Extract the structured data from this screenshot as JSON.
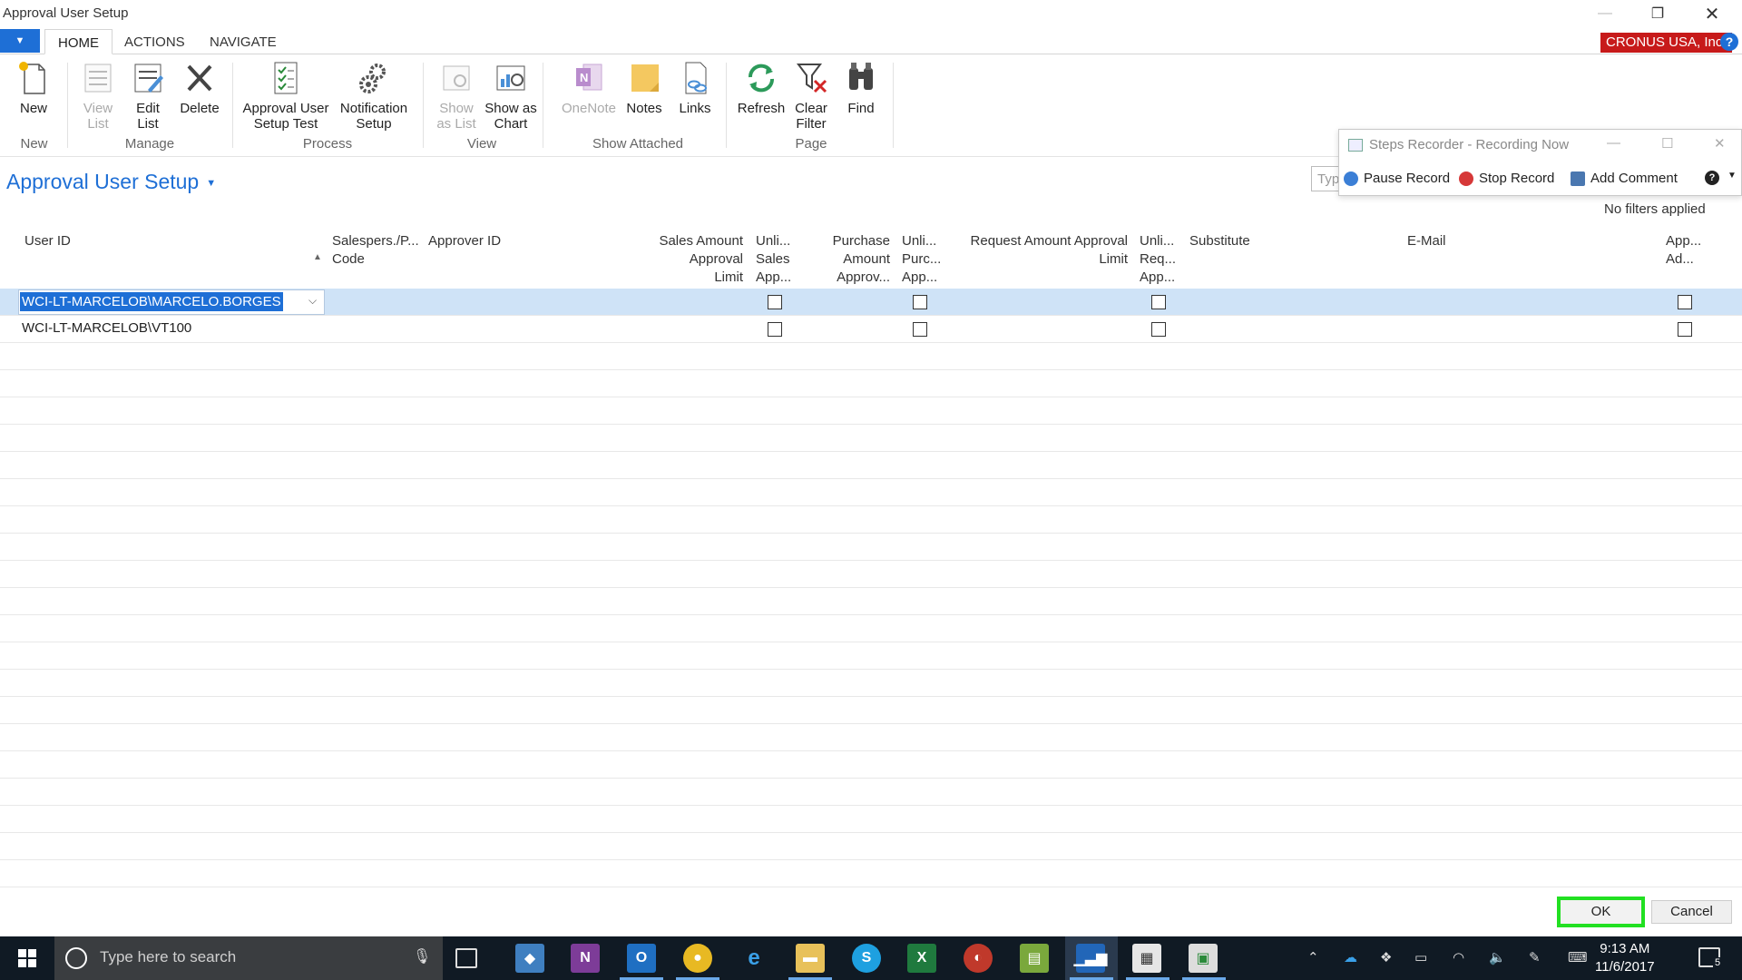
{
  "window": {
    "title": "Approval User Setup"
  },
  "ribbon_tabs": [
    "HOME",
    "ACTIONS",
    "NAVIGATE"
  ],
  "company_badge": "CRONUS USA, Inc.",
  "help_label": "?",
  "ribbon": {
    "buttons": [
      {
        "label": "New"
      },
      {
        "label": "View\nList"
      },
      {
        "label": "Edit\nList"
      },
      {
        "label": "Delete"
      },
      {
        "label": "Approval User\nSetup Test"
      },
      {
        "label": "Notification\nSetup"
      },
      {
        "label": "Show\nas List"
      },
      {
        "label": "Show as\nChart"
      },
      {
        "label": "OneNote"
      },
      {
        "label": "Notes"
      },
      {
        "label": "Links"
      },
      {
        "label": "Refresh"
      },
      {
        "label": "Clear\nFilter"
      },
      {
        "label": "Find"
      }
    ],
    "groups": [
      "New",
      "Manage",
      "Process",
      "View",
      "Show Attached",
      "Page"
    ]
  },
  "page": {
    "title": "Approval User Setup",
    "search_placeholder": "Typ",
    "filter_status": "No filters applied"
  },
  "grid": {
    "columns": [
      "User ID",
      "Salespers./P...\nCode",
      "Approver ID",
      "Sales Amount\nApproval\nLimit",
      "Unli...\nSales\nApp...",
      "Purchase\nAmount\nApprov...",
      "Unli...\nPurc...\nApp...",
      "Request Amount Approval\nLimit",
      "Unli...\nReq...\nApp...",
      "Substitute",
      "E-Mail",
      "App...\nAd..."
    ],
    "rows": [
      {
        "user_id": "WCI-LT-MARCELOB\\MARCELO.BORGES",
        "selected": true
      },
      {
        "user_id": "WCI-LT-MARCELOB\\VT100",
        "selected": false
      }
    ]
  },
  "steps_recorder": {
    "title": "Steps Recorder - Recording Now",
    "pause": "Pause Record",
    "stop": "Stop Record",
    "comment": "Add Comment"
  },
  "dialog": {
    "ok": "OK",
    "cancel": "Cancel"
  },
  "taskbar": {
    "search_placeholder": "Type here to search",
    "time": "9:13 AM",
    "date": "11/6/2017",
    "notification_count": "5"
  },
  "colors": {
    "accent": "#1e6fd6",
    "company": "#c71a1a",
    "selection_row": "#cfe3f7",
    "ok_highlight": "#22e022",
    "taskbar": "#101a24"
  }
}
